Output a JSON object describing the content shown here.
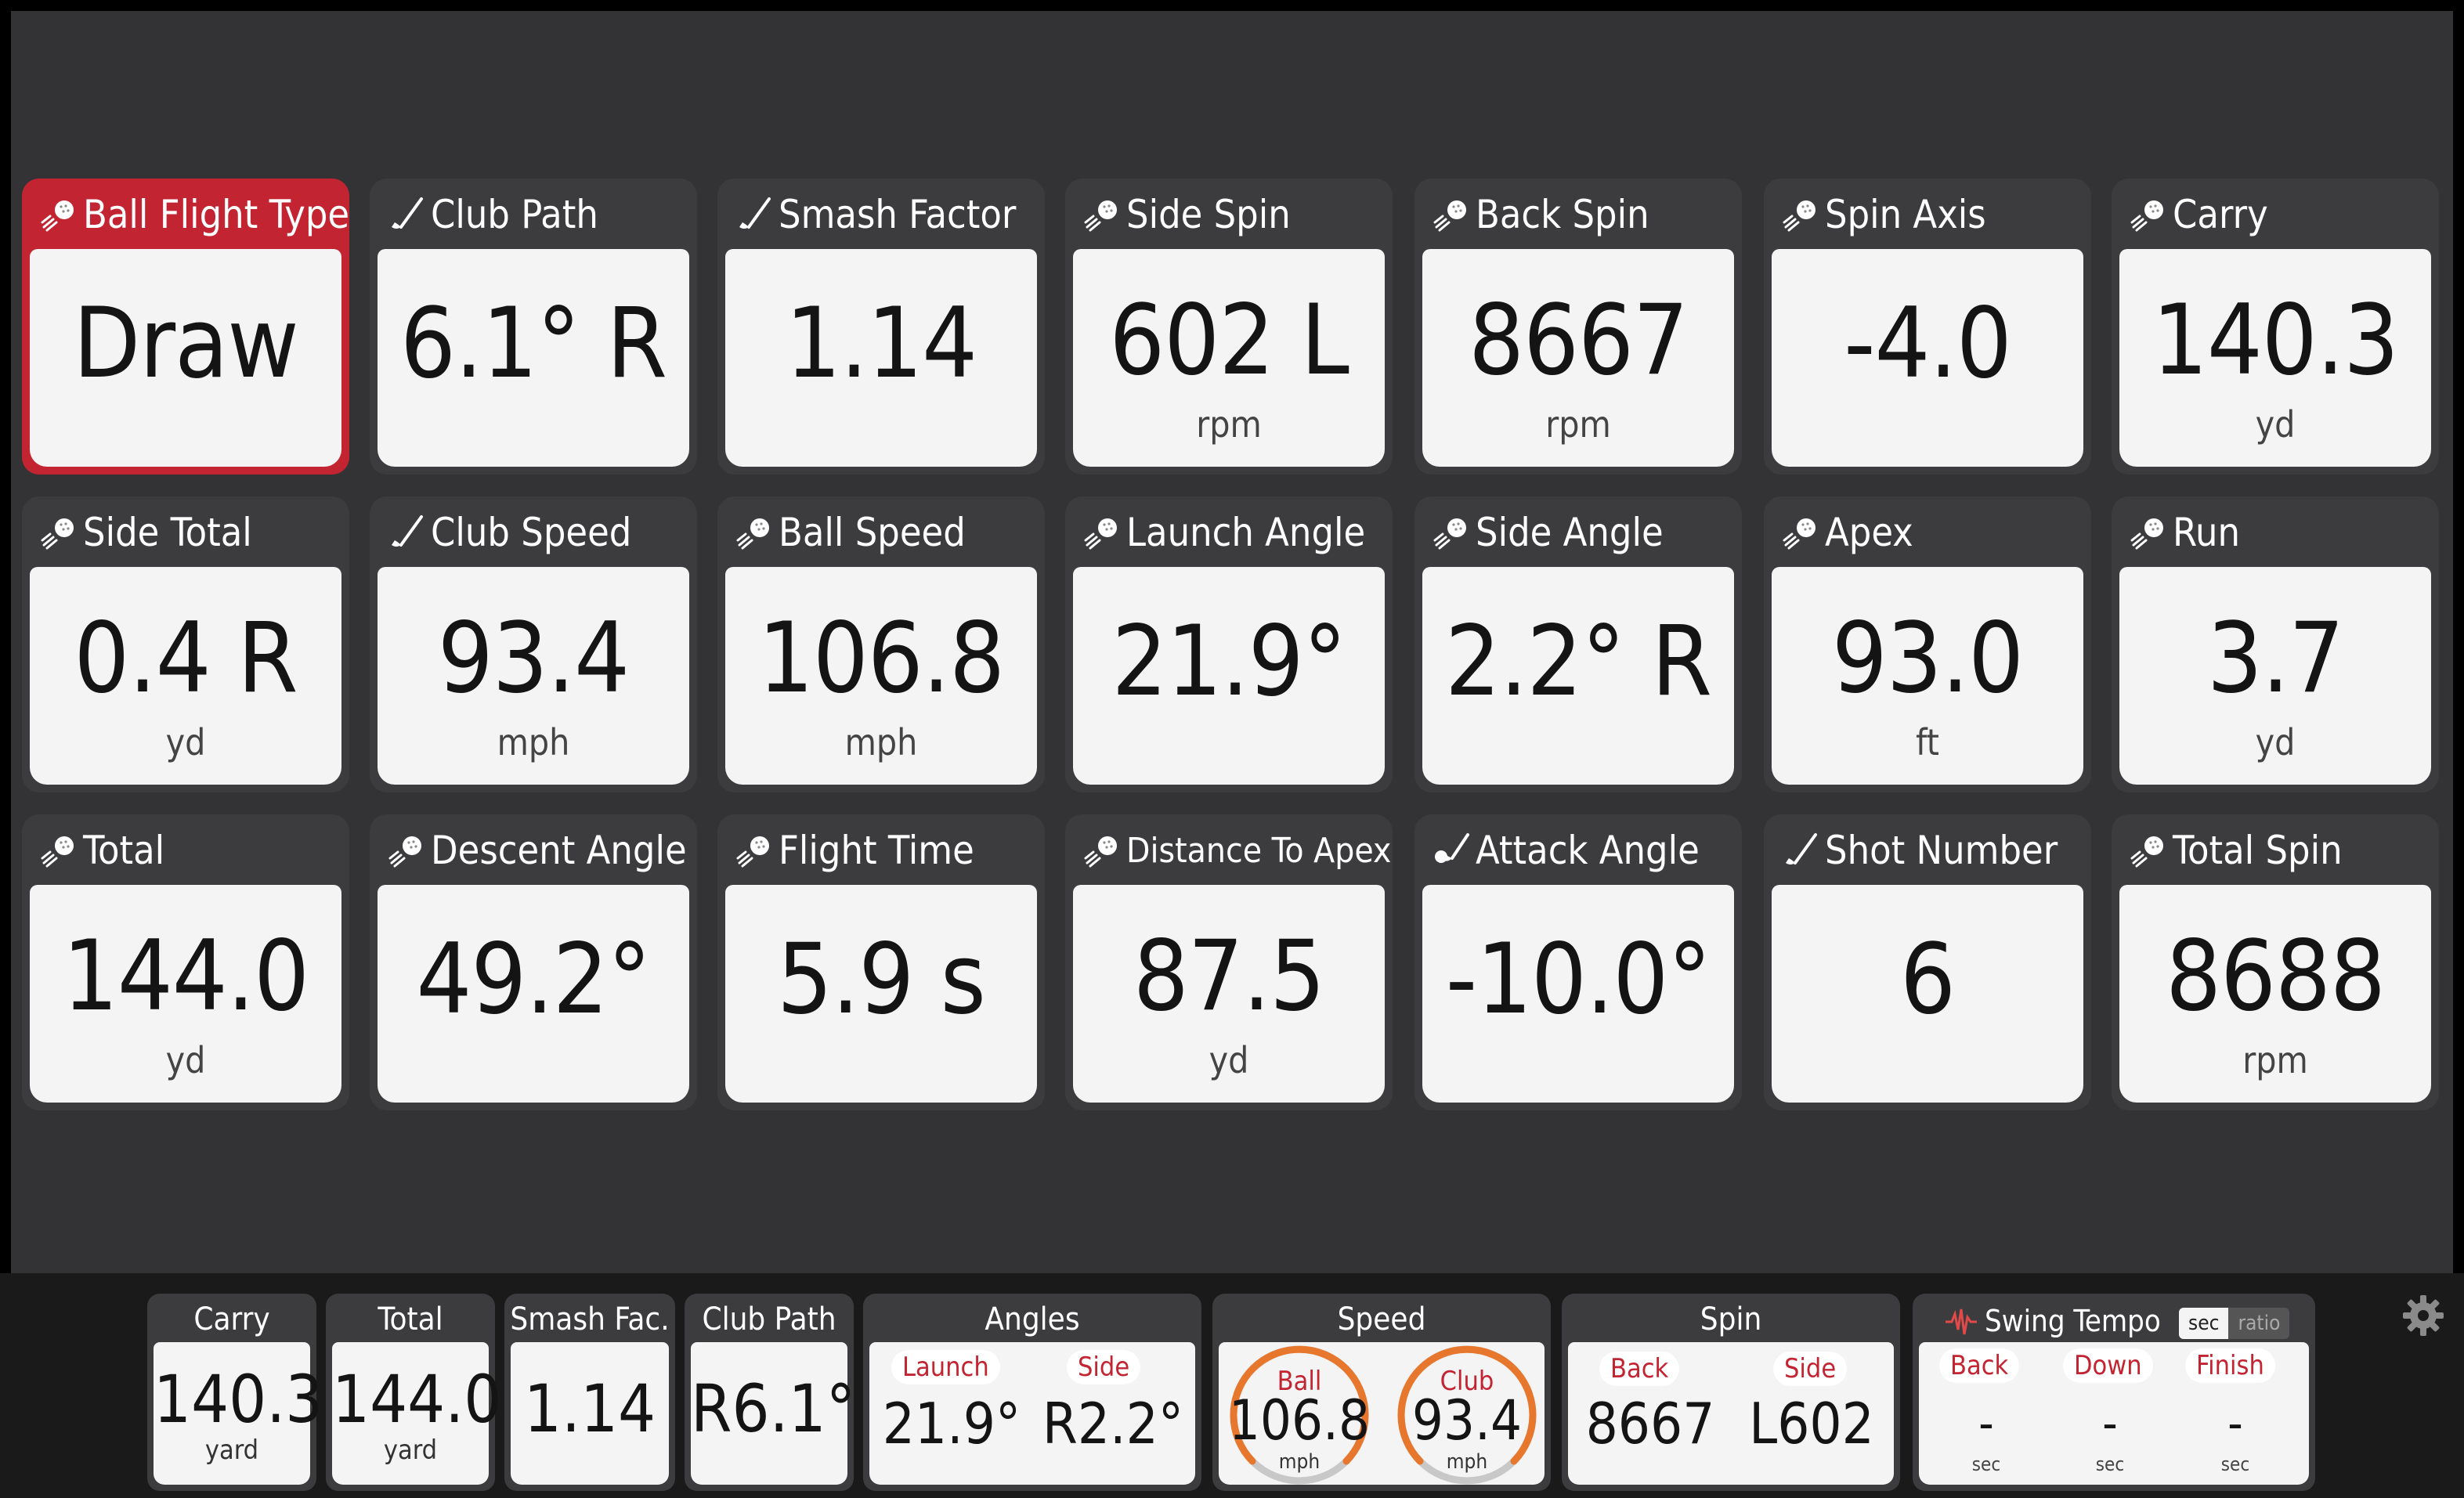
{
  "tiles": [
    {
      "label": "Ball Flight Type",
      "icon": "ball-icon",
      "value": "Draw",
      "unit": "",
      "selected": true
    },
    {
      "label": "Club Path",
      "icon": "club-icon",
      "value": "6.1° R",
      "unit": ""
    },
    {
      "label": "Smash Factor",
      "icon": "club-icon",
      "value": "1.14",
      "unit": ""
    },
    {
      "label": "Side Spin",
      "icon": "ball-icon",
      "value": "602 L",
      "unit": "rpm"
    },
    {
      "label": "Back Spin",
      "icon": "ball-icon",
      "value": "8667",
      "unit": "rpm"
    },
    {
      "label": "Spin Axis",
      "icon": "ball-icon",
      "value": "-4.0",
      "unit": ""
    },
    {
      "label": "Carry",
      "icon": "ball-icon",
      "value": "140.3",
      "unit": "yd"
    },
    {
      "label": "Side Total",
      "icon": "ball-icon",
      "value": "0.4 R",
      "unit": "yd"
    },
    {
      "label": "Club Speed",
      "icon": "club-icon",
      "value": "93.4",
      "unit": "mph"
    },
    {
      "label": "Ball Speed",
      "icon": "ball-icon",
      "value": "106.8",
      "unit": "mph"
    },
    {
      "label": "Launch Angle",
      "icon": "ball-icon",
      "value": "21.9°",
      "unit": ""
    },
    {
      "label": "Side Angle",
      "icon": "ball-icon",
      "value": "2.2° R",
      "unit": ""
    },
    {
      "label": "Apex",
      "icon": "ball-icon",
      "value": "93.0",
      "unit": "ft"
    },
    {
      "label": "Run",
      "icon": "ball-icon",
      "value": "3.7",
      "unit": "yd"
    },
    {
      "label": "Total",
      "icon": "ball-icon",
      "value": "144.0",
      "unit": "yd"
    },
    {
      "label": "Descent Angle",
      "icon": "ball-icon",
      "value": "49.2°",
      "unit": ""
    },
    {
      "label": "Flight Time",
      "icon": "ball-icon",
      "value": "5.9 s",
      "unit": ""
    },
    {
      "label": "Distance To Apex",
      "icon": "ball-icon",
      "value": "87.5",
      "unit": "yd",
      "small": true
    },
    {
      "label": "Attack Angle",
      "icon": "club-ball-icon",
      "value": "-10.0°",
      "unit": ""
    },
    {
      "label": "Shot Number",
      "icon": "club-icon",
      "value": "6",
      "unit": ""
    },
    {
      "label": "Total Spin",
      "icon": "ball-icon",
      "value": "8688",
      "unit": "rpm"
    }
  ],
  "bottom": {
    "carry": {
      "label": "Carry",
      "value": "140.3",
      "unit": "yard"
    },
    "total": {
      "label": "Total",
      "value": "144.0",
      "unit": "yard"
    },
    "smash": {
      "label": "Smash Fac.",
      "value": "1.14"
    },
    "club_path": {
      "label": "Club Path",
      "value": "R6.1°"
    },
    "angles": {
      "label": "Angles",
      "launch_label": "Launch",
      "launch_value": "21.9°",
      "side_label": "Side",
      "side_value": "R2.2°"
    },
    "speed": {
      "label": "Speed",
      "ball_label": "Ball",
      "ball_value": "106.8",
      "ball_unit": "mph",
      "club_label": "Club",
      "club_value": "93.4",
      "club_unit": "mph"
    },
    "spin": {
      "label": "Spin",
      "back_label": "Back",
      "back_value": "8667",
      "side_label": "Side",
      "side_value": "L602"
    },
    "tempo": {
      "label": "Swing Tempo",
      "toggle_sec": "sec",
      "toggle_ratio": "ratio",
      "back_label": "Back",
      "down_label": "Down",
      "finish_label": "Finish",
      "back_value": "-",
      "down_value": "-",
      "finish_value": "-",
      "back_unit": "sec",
      "down_unit": "sec",
      "finish_unit": "sec"
    }
  },
  "settings_icon": "gear-icon",
  "colors": {
    "accent": "#c32432",
    "tile_header": "#3c3c3e",
    "tile_body": "#f4f4f4",
    "background": "#333335",
    "gauge": "#e8772e"
  }
}
